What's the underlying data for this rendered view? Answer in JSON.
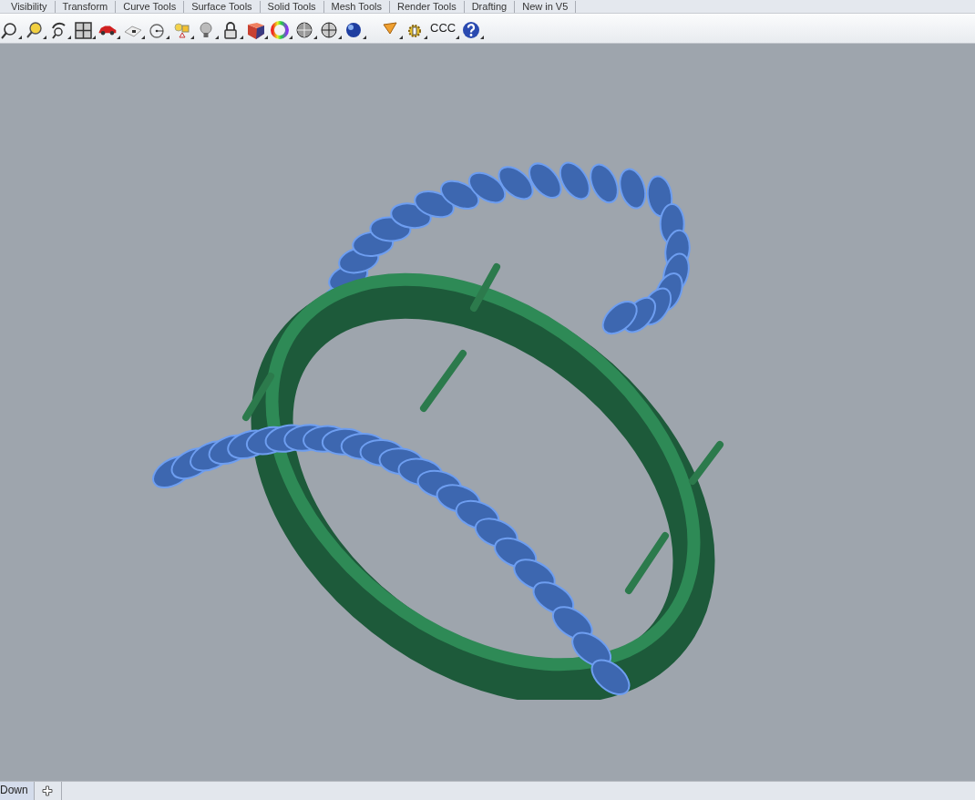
{
  "tabs": [
    {
      "label": "Visibility"
    },
    {
      "label": "Transform"
    },
    {
      "label": "Curve Tools"
    },
    {
      "label": "Surface Tools"
    },
    {
      "label": "Solid Tools"
    },
    {
      "label": "Mesh Tools"
    },
    {
      "label": "Render Tools"
    },
    {
      "label": "Drafting"
    },
    {
      "label": "New in V5"
    }
  ],
  "toolbar": [
    {
      "kind": "zoom"
    },
    {
      "kind": "zoom-selected"
    },
    {
      "kind": "rotate"
    },
    {
      "kind": "viewports"
    },
    {
      "kind": "car"
    },
    {
      "kind": "grid"
    },
    {
      "kind": "circle"
    },
    {
      "kind": "shapes"
    },
    {
      "kind": "bulb"
    },
    {
      "kind": "lock"
    },
    {
      "kind": "book"
    },
    {
      "kind": "color-wheel"
    },
    {
      "kind": "sphere"
    },
    {
      "kind": "mesh-sphere"
    },
    {
      "kind": "blue-sphere"
    },
    {
      "kind": "gap"
    },
    {
      "kind": "cone"
    },
    {
      "kind": "gears"
    },
    {
      "kind": "text",
      "label": "CCC"
    },
    {
      "kind": "help"
    }
  ],
  "viewport_tabs": [
    {
      "label": "Down",
      "selected": true
    }
  ]
}
